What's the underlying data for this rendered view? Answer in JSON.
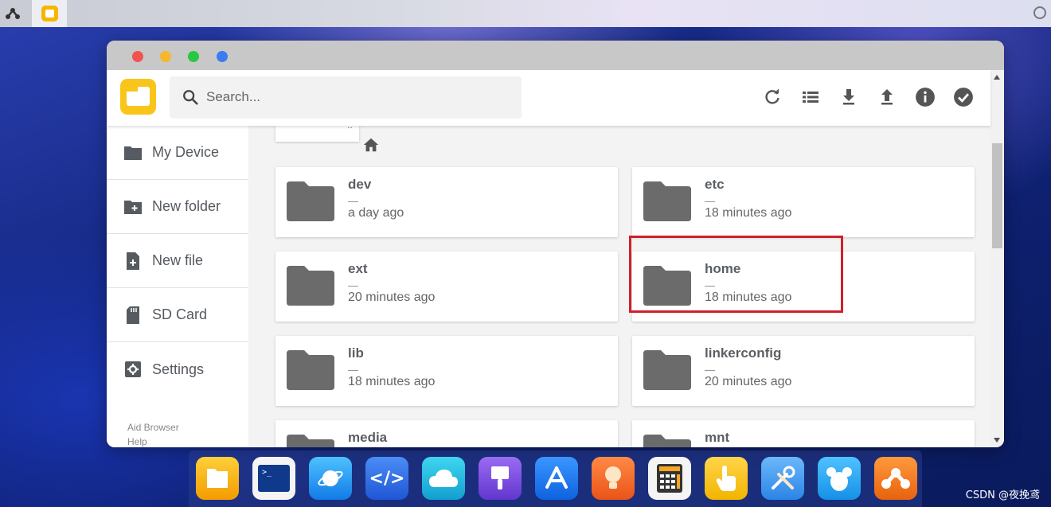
{
  "desktop": {
    "watermark": "CSDN @夜挽鸢"
  },
  "window": {
    "search": {
      "placeholder": "Search..."
    },
    "toolbar": [
      {
        "icon": "refresh-icon"
      },
      {
        "icon": "list-view-icon"
      },
      {
        "icon": "download-icon"
      },
      {
        "icon": "upload-icon"
      },
      {
        "icon": "info-icon"
      },
      {
        "icon": "select-all-icon"
      }
    ],
    "sidebar": {
      "items": [
        {
          "label": "My Device",
          "icon": "folder-icon"
        },
        {
          "label": "New folder",
          "icon": "new-folder-icon"
        },
        {
          "label": "New file",
          "icon": "new-file-icon"
        },
        {
          "label": "SD Card",
          "icon": "sd-card-icon"
        },
        {
          "label": "Settings",
          "icon": "settings-icon"
        }
      ],
      "footer": [
        "Aid Browser",
        "Help"
      ]
    },
    "files": [
      {
        "name": "dev",
        "dash": "—",
        "time": "a day ago"
      },
      {
        "name": "etc",
        "dash": "—",
        "time": "18 minutes ago"
      },
      {
        "name": "ext",
        "dash": "—",
        "time": "20 minutes ago"
      },
      {
        "name": "home",
        "dash": "—",
        "time": "18 minutes ago"
      },
      {
        "name": "lib",
        "dash": "—",
        "time": "18 minutes ago"
      },
      {
        "name": "linkerconfig",
        "dash": "—",
        "time": "20 minutes ago"
      },
      {
        "name": "media",
        "dash": "—",
        "time": ""
      },
      {
        "name": "mnt",
        "dash": "—",
        "time": ""
      }
    ],
    "highlighted_file": "home"
  },
  "dock": {
    "apps": [
      {
        "icon": "files-app-icon",
        "color": "#f7b500"
      },
      {
        "icon": "terminal-app-icon",
        "color": "#ffffff"
      },
      {
        "icon": "browser-planet-icon",
        "color": "#1e9bf0"
      },
      {
        "icon": "code-editor-icon",
        "color": "#2f6fe4"
      },
      {
        "icon": "cloud-app-icon",
        "color": "#25b9d9"
      },
      {
        "icon": "paint-brush-icon",
        "color": "#7b4be0"
      },
      {
        "icon": "app-store-icon",
        "color": "#1d7bf2"
      },
      {
        "icon": "light-bulb-icon",
        "color": "#f36a2c"
      },
      {
        "icon": "calculator-icon",
        "color": "#f4f4f4"
      },
      {
        "icon": "touch-hand-icon",
        "color": "#f7c21a"
      },
      {
        "icon": "tools-icon",
        "color": "#4aa2f2"
      },
      {
        "icon": "mouse-app-icon",
        "color": "#2ca8f0"
      },
      {
        "icon": "aid-launcher-icon",
        "color": "#f27a1a"
      }
    ]
  }
}
